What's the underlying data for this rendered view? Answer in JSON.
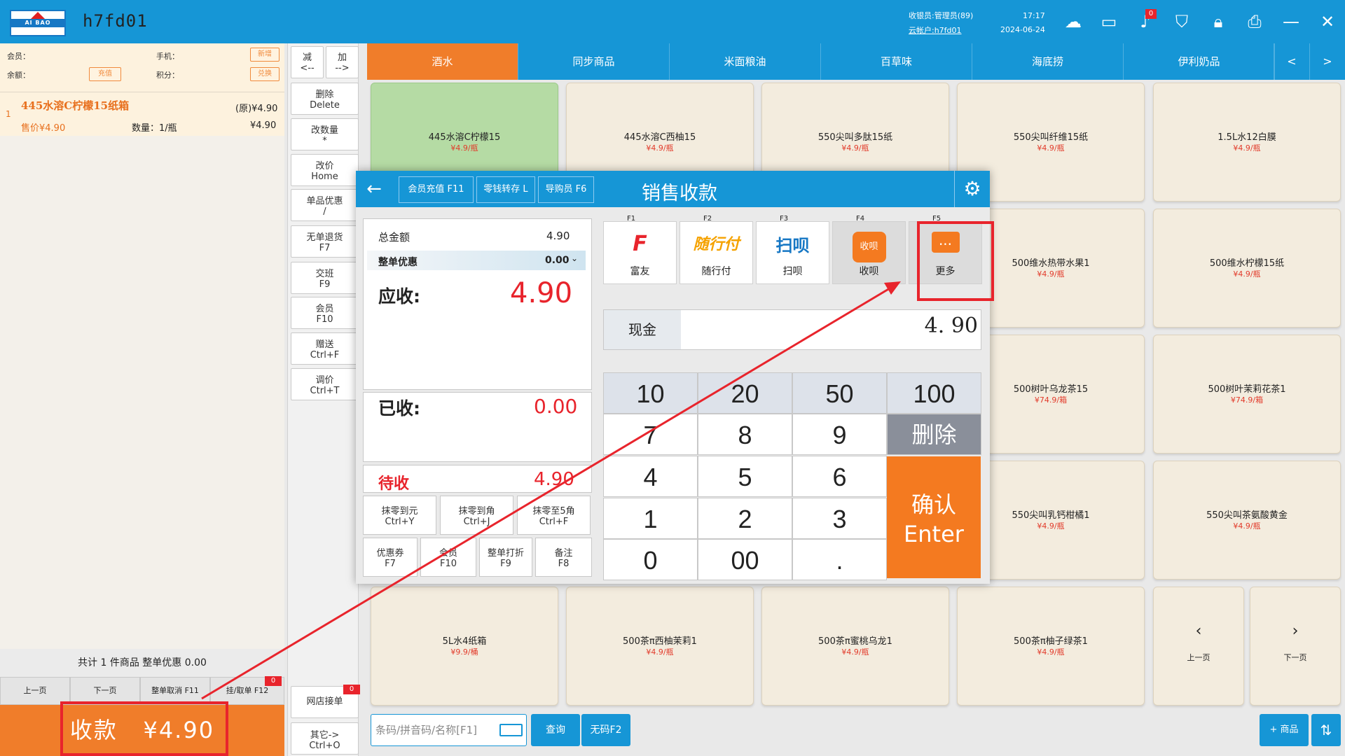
{
  "topbar": {
    "store": "h7fd01",
    "logo_text": "AI BAO",
    "cashier": "收银员:管理员(89)",
    "cloud": "云帐户:h7fd01",
    "time": "17:17",
    "date": "2024-06-24",
    "notif_count": "0"
  },
  "member": {
    "member_label": "会员：",
    "phone_label": "手机：",
    "balance_label": "余额：",
    "points_label": "积分：",
    "add_btn": "新增",
    "recharge_btn": "充值",
    "exchange_btn": "兑换"
  },
  "cart": {
    "items": [
      {
        "index": "1",
        "name": "445水溶C柠檬15纸箱",
        "orig": "(原)¥4.90",
        "sale": "售价¥4.90",
        "qty": "数量：1/瓶",
        "total": "¥4.90"
      }
    ],
    "summary": "共计 1 件商品 整单优惠 0.00",
    "prev": "上一页",
    "next": "下一页",
    "cancel": "整单取消 F11",
    "hold": "挂/取单 F12",
    "hold_count": "0",
    "pay_label": "收款",
    "pay_amount": "¥4.90"
  },
  "mid": {
    "dec": "减",
    "dec_arrow": "<--",
    "inc": "加",
    "inc_arrow": "-->",
    "buttons": [
      {
        "l1": "删除",
        "l2": "Delete"
      },
      {
        "l1": "改数量",
        "l2": "*"
      },
      {
        "l1": "改价",
        "l2": "Home"
      },
      {
        "l1": "单品优惠",
        "l2": "/"
      },
      {
        "l1": "无单退货",
        "l2": "F7"
      },
      {
        "l1": "交班",
        "l2": "F9"
      },
      {
        "l1": "会员",
        "l2": "F10"
      },
      {
        "l1": "赠送",
        "l2": "Ctrl+F"
      },
      {
        "l1": "调价",
        "l2": "Ctrl+T"
      }
    ],
    "online": "网店接单",
    "online_count": "0",
    "other_l1": "其它->",
    "other_l2": "Ctrl+O"
  },
  "categories": [
    "酒水",
    "同步商品",
    "米面粮油",
    "百草味",
    "海底捞",
    "伊利奶品"
  ],
  "products": [
    {
      "name": "445水溶C柠檬15",
      "price": "¥4.9/瓶"
    },
    {
      "name": "445水溶C西柚15",
      "price": "¥4.9/瓶"
    },
    {
      "name": "550尖叫多肽15纸",
      "price": "¥4.9/瓶"
    },
    {
      "name": "550尖叫纤维15纸",
      "price": "¥4.9/瓶"
    },
    {
      "name": "1.5L水12白膜",
      "price": "¥4.9/瓶"
    },
    {
      "name": "500维水热带水果1",
      "price": "¥4.9/瓶"
    },
    {
      "name": "500维水柠檬15纸",
      "price": "¥4.9/瓶"
    },
    {
      "name": "500树叶乌龙茶15",
      "price": "¥74.9/箱"
    },
    {
      "name": "500树叶茉莉花茶1",
      "price": "¥74.9/箱"
    },
    {
      "name": "550尖叫乳钙柑橘1",
      "price": "¥4.9/瓶"
    },
    {
      "name": "550尖叫茶氨酸黄金",
      "price": "¥4.9/瓶"
    },
    {
      "name": "5L水4纸箱",
      "price": "¥9.9/桶"
    },
    {
      "name": "500茶π西柚茉莉1",
      "price": "¥4.9/瓶"
    },
    {
      "name": "500茶π蜜桃乌龙1",
      "price": "¥4.9/瓶"
    },
    {
      "name": "500茶π柚子绿茶1",
      "price": "¥4.9/瓶"
    }
  ],
  "grid_nav": {
    "prev": "上一页",
    "next": "下一页"
  },
  "bottom": {
    "search_placeholder": "条码/拼音码/名称[F1]",
    "query": "查询",
    "nocode": "无码F2",
    "add_goods": "+ 商品"
  },
  "dialog": {
    "title": "销售收款",
    "hbtn1": "会员充值 F11",
    "hbtn2": "零钱转存 L",
    "hbtn3": "导购员 F6",
    "total_label": "总金额",
    "total": "4.90",
    "discount_label": "整单优惠",
    "discount": "0.00",
    "due_label": "应收:",
    "due": "4.90",
    "received_label": "已收:",
    "received": "0.00",
    "pending_label": "待收",
    "pending": "4.90",
    "ops": [
      {
        "l1": "抹零到元",
        "l2": "Ctrl+Y"
      },
      {
        "l1": "抹零到角",
        "l2": "Ctrl+J"
      },
      {
        "l1": "抹零至5角",
        "l2": "Ctrl+F"
      }
    ],
    "ops2": [
      {
        "l1": "优惠券",
        "l2": "F7"
      },
      {
        "l1": "会员",
        "l2": "F10"
      },
      {
        "l1": "整单打折",
        "l2": "F9"
      },
      {
        "l1": "备注",
        "l2": "F8"
      }
    ],
    "methods": [
      {
        "key": "F1",
        "label": "富友",
        "logo": "F"
      },
      {
        "key": "F2",
        "label": "随行付",
        "logo": "随行付"
      },
      {
        "key": "F3",
        "label": "扫呗",
        "logo": "扫呗"
      },
      {
        "key": "F4",
        "label": "收呗",
        "logo": "收呗"
      },
      {
        "key": "F5",
        "label": "更多",
        "logo": "..."
      }
    ],
    "cash_label": "现金",
    "cash_value": "4. 90",
    "keys": [
      "10",
      "20",
      "50",
      "100",
      "7",
      "8",
      "9",
      "删除",
      "4",
      "5",
      "6",
      "1",
      "2",
      "3",
      "0",
      "00",
      "."
    ],
    "confirm_l1": "确认",
    "confirm_l2": "Enter"
  },
  "colors": {
    "accent": "#1696d6",
    "orange": "#f07d2a",
    "highlight": "#e8242c"
  }
}
